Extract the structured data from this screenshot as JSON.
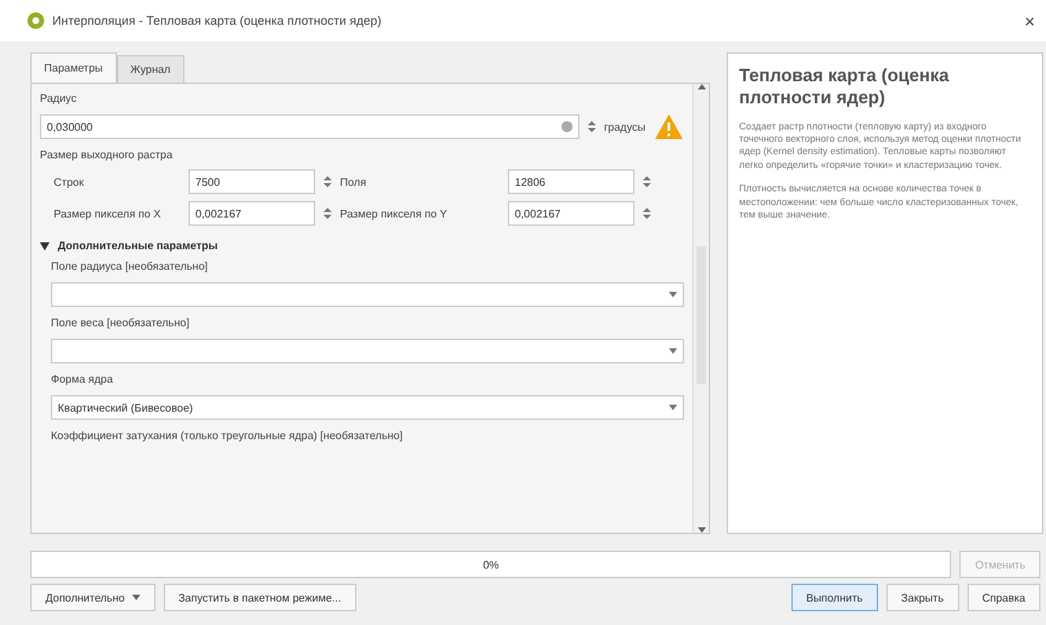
{
  "window": {
    "title": "Интерполяция - Тепловая карта (оценка плотности ядер)",
    "close": "×"
  },
  "tabs": [
    {
      "label": "Параметры",
      "selected": true
    },
    {
      "label": "Журнал",
      "selected": false
    }
  ],
  "radius": {
    "label": "Радиус",
    "value": "0,030000",
    "units": "градусы"
  },
  "raster_size": {
    "label": "Размер выходного растра",
    "fields": [
      {
        "label": "Строк",
        "value": "7500"
      },
      {
        "label": "Поля",
        "value": "12806"
      },
      {
        "label": "Размер пикселя по X",
        "value": "0,002167"
      },
      {
        "label": "Размер пикселя по Y",
        "value": "0,002167"
      }
    ]
  },
  "advanced": {
    "label": "Дополнительные параметры",
    "expanded": true,
    "fields": [
      {
        "label": "Поле радиуса [необязательно]"
      },
      {
        "label": "Поле веса [необязательно]"
      },
      {
        "label": "Форма ядра",
        "value": "Квартический (Бивесовое)"
      }
    ],
    "trailing_label": "Коэффициент затухания (только треугольные ядра) [необязательно]"
  },
  "help": {
    "title": "Тепловая карта (оценка плотности ядер)",
    "paragraphs": [
      "Создает растр плотности (тепловую карту) из входного точечного векторного слоя, используя метод оценки плотности ядер (Kernel density estimation). Тепловые карты позволяют легко определить «горячие точки» и кластеризацию точек.",
      "Плотность вычисляется на основе количества точек в местоположении: чем больше число кластеризованных точек, тем выше значение."
    ]
  },
  "progress": {
    "level": 0,
    "label": "0%"
  },
  "buttons": {
    "cancel": {
      "label": "Отменить",
      "disabled": true
    },
    "advanced": "Дополнительно",
    "batch": "Запустить в пакетном режиме...",
    "run": "Выполнить",
    "close": "Закрыть",
    "help": "Справка"
  }
}
